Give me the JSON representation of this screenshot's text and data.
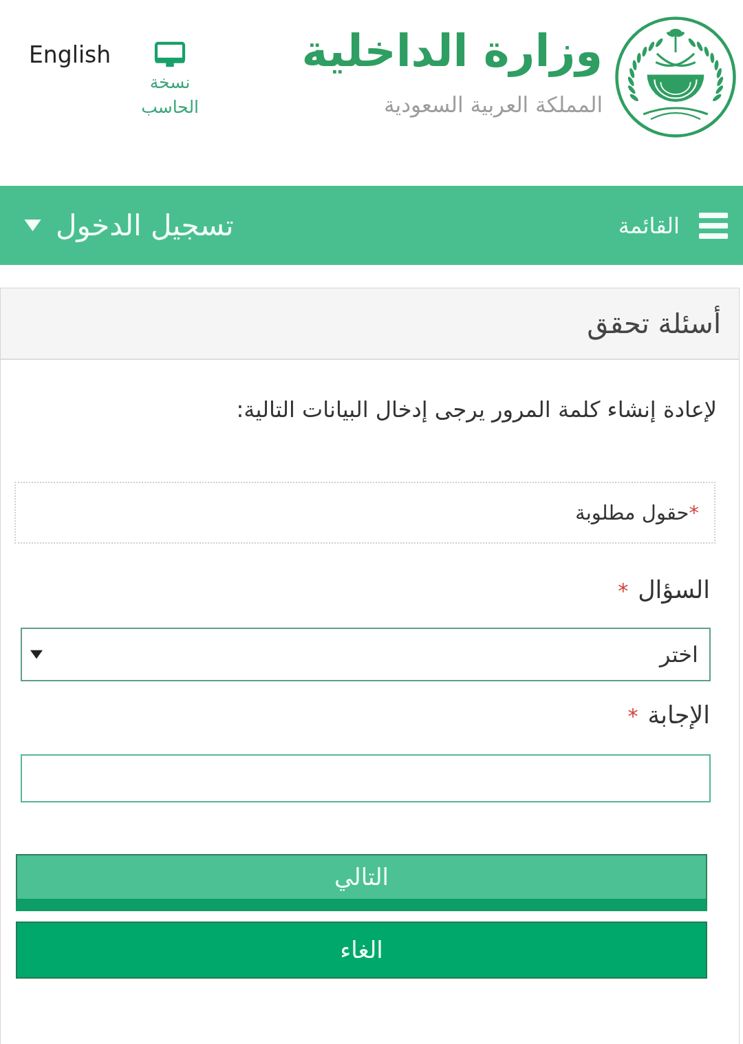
{
  "header": {
    "ministry_name": "وزارة الداخلية",
    "country_name": "المملكة العربية السعودية",
    "desktop_version": {
      "line_1": "نسخة",
      "line_2": "الحاسب"
    },
    "language_link": "English"
  },
  "nav_bar": {
    "menu_label": "القائمة",
    "login_label": "تسجيل الدخول"
  },
  "panel": {
    "title": "أسئلة تحقق",
    "instruction": "لإعادة إنشاء كلمة المرور يرجى إدخال البيانات التالية:",
    "required_note": {
      "marker": "*",
      "text": "حقول مطلوبة"
    },
    "fields": [
      {
        "kind": "select",
        "label": "السؤال",
        "required_mark": "*",
        "value": "اختر"
      },
      {
        "kind": "text",
        "label": "الإجابة",
        "required_mark": "*"
      }
    ],
    "buttons": [
      {
        "kind": "primary",
        "label": "التالي"
      },
      {
        "kind": "secondary",
        "label": "الغاء"
      }
    ]
  }
}
